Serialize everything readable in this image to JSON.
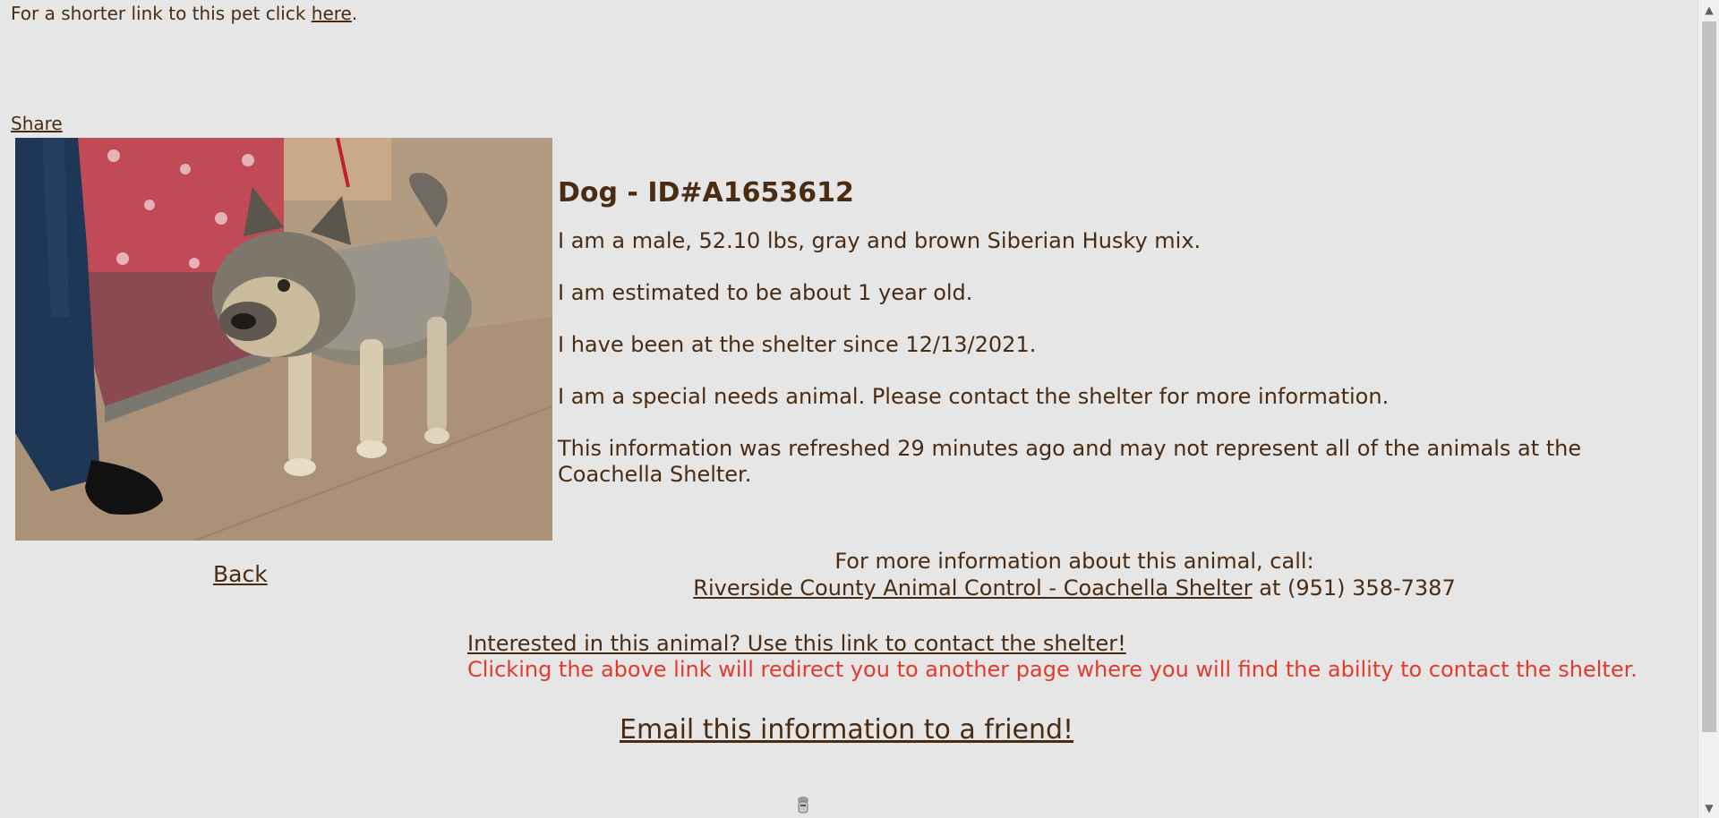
{
  "header": {
    "short_link_prefix": "For a shorter link to this pet click ",
    "short_link_label": "here",
    "short_link_suffix": "."
  },
  "share_label": "Share",
  "animal": {
    "title": "Dog - ID#A1653612",
    "description": "I am a male, 52.10 lbs, gray and brown Siberian Husky mix.",
    "age": "I am estimated to be about 1 year old.",
    "since": "I have been at the shelter since 12/13/2021.",
    "special_needs": "I am a special needs animal. Please contact the shelter for more information.",
    "refreshed": "This information was refreshed 29 minutes ago and may not represent all of the animals at the Coachella Shelter."
  },
  "back_label": "Back",
  "call": {
    "heading": "For more information about this animal, call:",
    "shelter_name": "Riverside County Animal Control - Coachella Shelter",
    "phone_text": " at (951) 358-7387"
  },
  "contact": {
    "link_label": "Interested in this animal? Use this link to contact the shelter!",
    "notice": "Clicking the above link will redirect you to another page where you will find the ability to contact the shelter."
  },
  "email_label": "Email this information to a friend!",
  "icons": {
    "scroll_up": "scroll-up-arrow-icon",
    "scroll_down": "scroll-down-arrow-icon",
    "loading": "loading-spinner-icon"
  },
  "colors": {
    "background": "#e6e6e6",
    "text": "#4a2c12",
    "warning": "#e23b2e"
  }
}
